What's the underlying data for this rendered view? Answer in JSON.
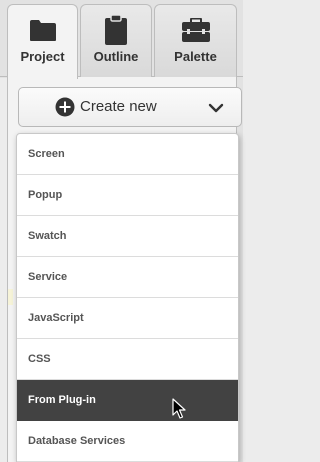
{
  "tabs": [
    {
      "label": "Project",
      "icon": "folder-icon",
      "active": true
    },
    {
      "label": "Outline",
      "icon": "clipboard-icon",
      "active": false
    },
    {
      "label": "Palette",
      "icon": "toolbox-icon",
      "active": false
    }
  ],
  "create_button": {
    "label": "Create new",
    "icon": "plus-circle-icon",
    "dropdown_icon": "chevron-down-icon"
  },
  "menu": {
    "items": [
      {
        "label": "Screen"
      },
      {
        "label": "Popup"
      },
      {
        "label": "Swatch"
      },
      {
        "label": "Service"
      },
      {
        "label": "JavaScript"
      },
      {
        "label": "CSS"
      },
      {
        "label": "From Plug-in"
      },
      {
        "label": "Database Services"
      }
    ],
    "selected_item": "From Plug-in",
    "selected_bg": "#424242"
  },
  "colors": {
    "tab_bg": "#e2e2e2",
    "active_tab_bg": "#f3f3f3",
    "icon": "#333333"
  }
}
